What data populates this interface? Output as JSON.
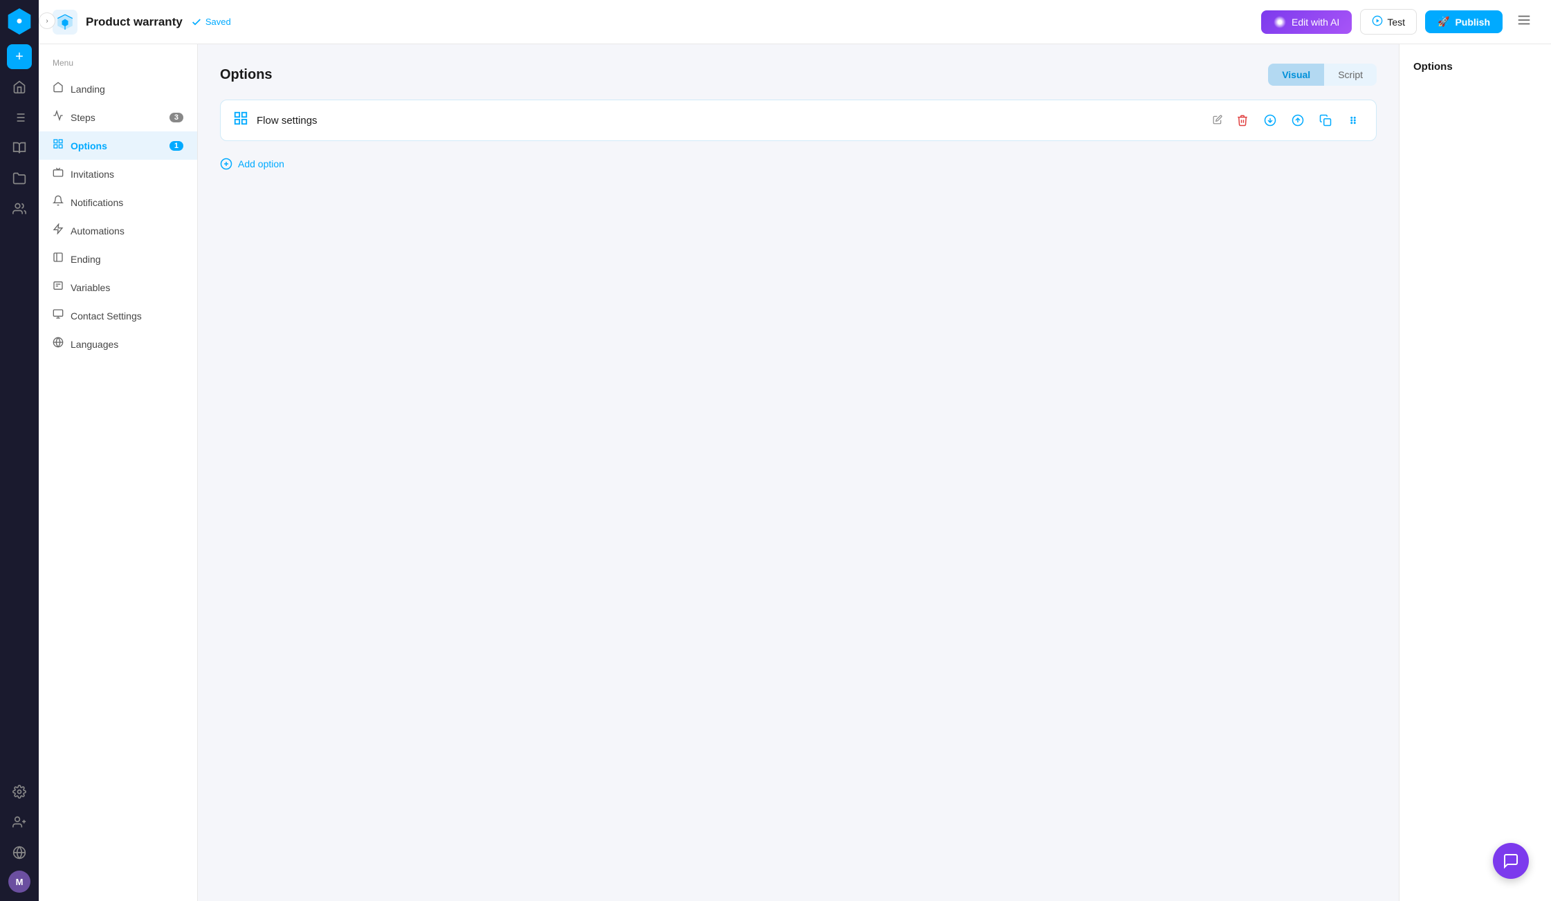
{
  "header": {
    "title": "Product warranty",
    "saved_label": "Saved",
    "edit_ai_label": "Edit with AI",
    "test_label": "Test",
    "publish_label": "Publish"
  },
  "sidebar": {
    "menu_label": "Menu",
    "items": [
      {
        "id": "landing",
        "label": "Landing",
        "badge": null
      },
      {
        "id": "steps",
        "label": "Steps",
        "badge": "3"
      },
      {
        "id": "options",
        "label": "Options",
        "badge": "1",
        "active": true
      },
      {
        "id": "invitations",
        "label": "Invitations",
        "badge": null
      },
      {
        "id": "notifications",
        "label": "Notifications",
        "badge": null
      },
      {
        "id": "automations",
        "label": "Automations",
        "badge": null
      },
      {
        "id": "ending",
        "label": "Ending",
        "badge": null
      },
      {
        "id": "variables",
        "label": "Variables",
        "badge": null
      },
      {
        "id": "contact-settings",
        "label": "Contact Settings",
        "badge": null
      },
      {
        "id": "languages",
        "label": "Languages",
        "badge": null
      }
    ]
  },
  "main": {
    "title": "Options",
    "tabs": [
      {
        "id": "visual",
        "label": "Visual",
        "active": true
      },
      {
        "id": "script",
        "label": "Script",
        "active": false
      }
    ],
    "flow_card": {
      "title": "Flow settings"
    },
    "add_option_label": "Add option"
  },
  "right_panel": {
    "title": "Options"
  },
  "icons": {
    "collapse": "›",
    "add": "+",
    "home": "⌂",
    "list": "≡",
    "book": "📋",
    "folder": "📁",
    "person": "👤",
    "globe": "🌐",
    "settings": "⚙",
    "add_user": "👤+",
    "avatar_letter": "M",
    "check": "✓",
    "rocket": "🚀",
    "play": "▶",
    "ai_sparkle": "✦",
    "pencil": "✎",
    "delete": "🗑",
    "down": "↓",
    "up": "↑",
    "copy": "⧉",
    "move": "✥",
    "chat": "💬",
    "plus_circle": "⊕"
  },
  "colors": {
    "accent": "#00aaff",
    "purple": "#7c3aed",
    "active_bg": "#e8f4fd",
    "active_text": "#00aaff"
  }
}
